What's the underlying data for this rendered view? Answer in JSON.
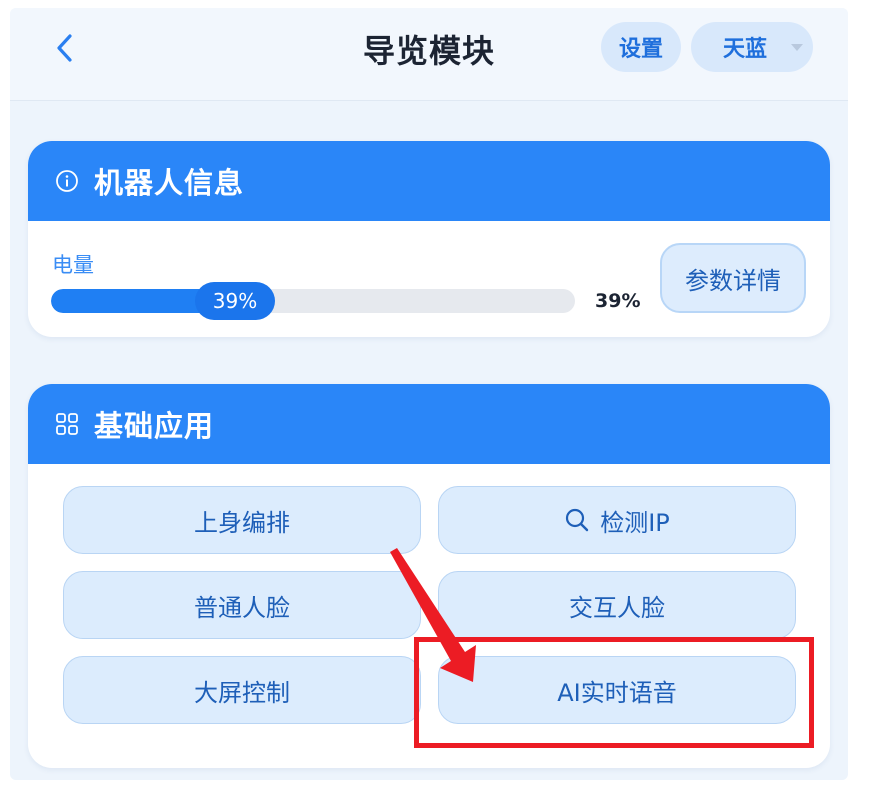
{
  "header": {
    "title": "导览模块",
    "settings_label": "设置",
    "theme_label": "天蓝"
  },
  "robot_info": {
    "title": "机器人信息",
    "battery_label": "电量",
    "battery_percent": 39,
    "battery_badge": "39%",
    "battery_value_text": "39%",
    "detail_button": "参数详情"
  },
  "apps": {
    "title": "基础应用",
    "items": [
      {
        "label": "上身编排",
        "icon": ""
      },
      {
        "label": "检测IP",
        "icon": "search-icon"
      },
      {
        "label": "普通人脸",
        "icon": ""
      },
      {
        "label": "交互人脸",
        "icon": ""
      },
      {
        "label": "大屏控制",
        "icon": ""
      },
      {
        "label": "AI实时语音",
        "icon": ""
      }
    ]
  },
  "colors": {
    "accent": "#2a86f8",
    "button_bg": "#dcecfd",
    "highlight": "#ec1c24"
  }
}
